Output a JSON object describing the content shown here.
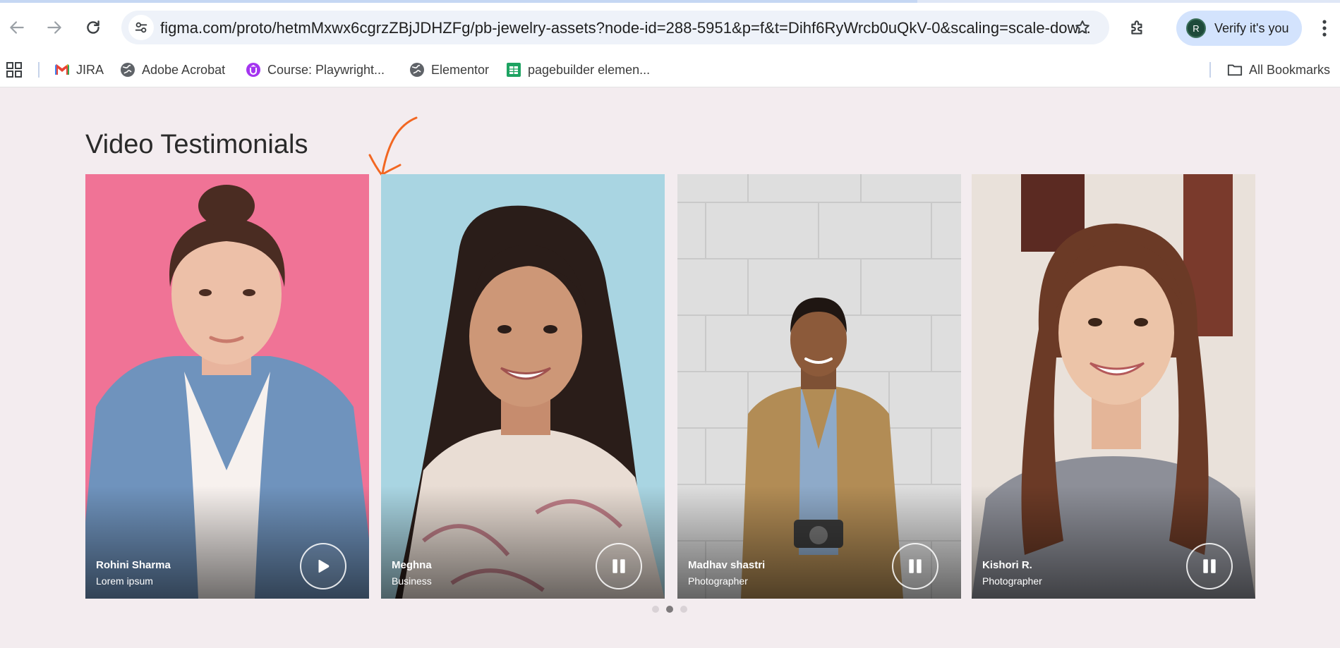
{
  "browser": {
    "url": "figma.com/proto/hetmMxwx6cgrzZBjJDHZFg/pb-jewelry-assets?node-id=288-5951&p=f&t=Dihf6RyWrcb0uQkV-0&scaling=scale-dow...",
    "verify_label": "Verify it's you",
    "avatar_initial": "R",
    "bookmarks": [
      {
        "label": "JIRA",
        "icon": "gmail-icon"
      },
      {
        "label": "Adobe Acrobat",
        "icon": "globe-icon"
      },
      {
        "label": "Course: Playwright...",
        "icon": "udemy-icon"
      },
      {
        "label": "Elementor",
        "icon": "globe-icon"
      },
      {
        "label": "pagebuilder elemen...",
        "icon": "sheets-icon"
      }
    ],
    "all_bookmarks_label": "All Bookmarks"
  },
  "page": {
    "section_title": "Video Testimonials",
    "testimonials": [
      {
        "name": "Rohini Sharma",
        "role": "Lorem ipsum",
        "control": "play",
        "bg_color": "#f07396"
      },
      {
        "name": "Meghna",
        "role": "Business",
        "control": "pause",
        "bg_color": "#a9d5e2"
      },
      {
        "name": "Madhav shastri",
        "role": "Photographer",
        "control": "pause",
        "bg_color": "#dedede"
      },
      {
        "name": "Kishori R.",
        "role": "Photographer",
        "control": "pause",
        "bg_color": "#e9e1da"
      }
    ],
    "carousel": {
      "pages": 3,
      "active_page": 2
    }
  },
  "colors": {
    "annotation_arrow": "#f26722",
    "verify_bg": "#d3e3fd",
    "omnibox_bg": "#eef2f9",
    "page_bg": "#f3ecef"
  }
}
